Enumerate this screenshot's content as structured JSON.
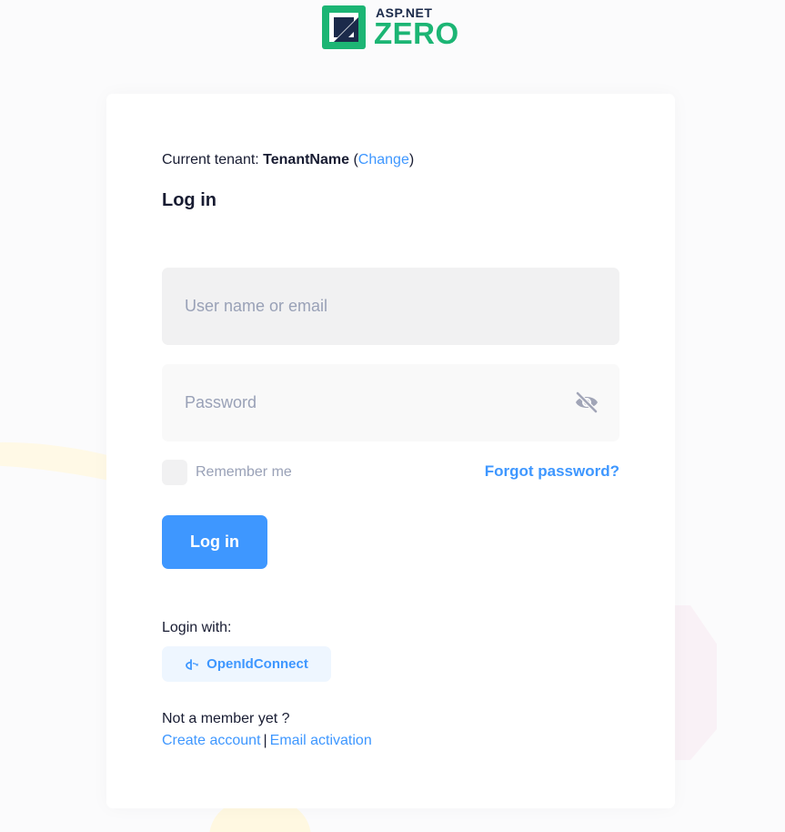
{
  "logo": {
    "top_text": "ASP.NET",
    "bottom_text": "ZERO",
    "icon": "aspnet-zero-logo",
    "colors": {
      "green": "#1cb574",
      "navy": "#1b2a4a"
    }
  },
  "tenant": {
    "prefix": "Current tenant: ",
    "name": "TenantName",
    "open_paren": " (",
    "change_label": "Change",
    "close_paren": ")"
  },
  "form": {
    "title": "Log in",
    "username_placeholder": "User name or email",
    "username_value": "",
    "password_placeholder": "Password",
    "password_value": "",
    "password_toggle_icon": "eye-slash-icon",
    "remember_label": "Remember me",
    "remember_checked": false,
    "forgot_label": "Forgot password?",
    "submit_label": "Log in"
  },
  "external": {
    "heading": "Login with:",
    "providers": [
      {
        "label": "OpenIdConnect",
        "icon": "openid-icon"
      }
    ]
  },
  "signup": {
    "prompt": "Not a member yet ?",
    "create_label": "Create account",
    "separator": "|",
    "activation_label": "Email activation"
  },
  "colors": {
    "primary": "#3e97ff",
    "text": "#181c32",
    "muted": "#99a1b7",
    "input_bg": "#f1f1f2"
  }
}
